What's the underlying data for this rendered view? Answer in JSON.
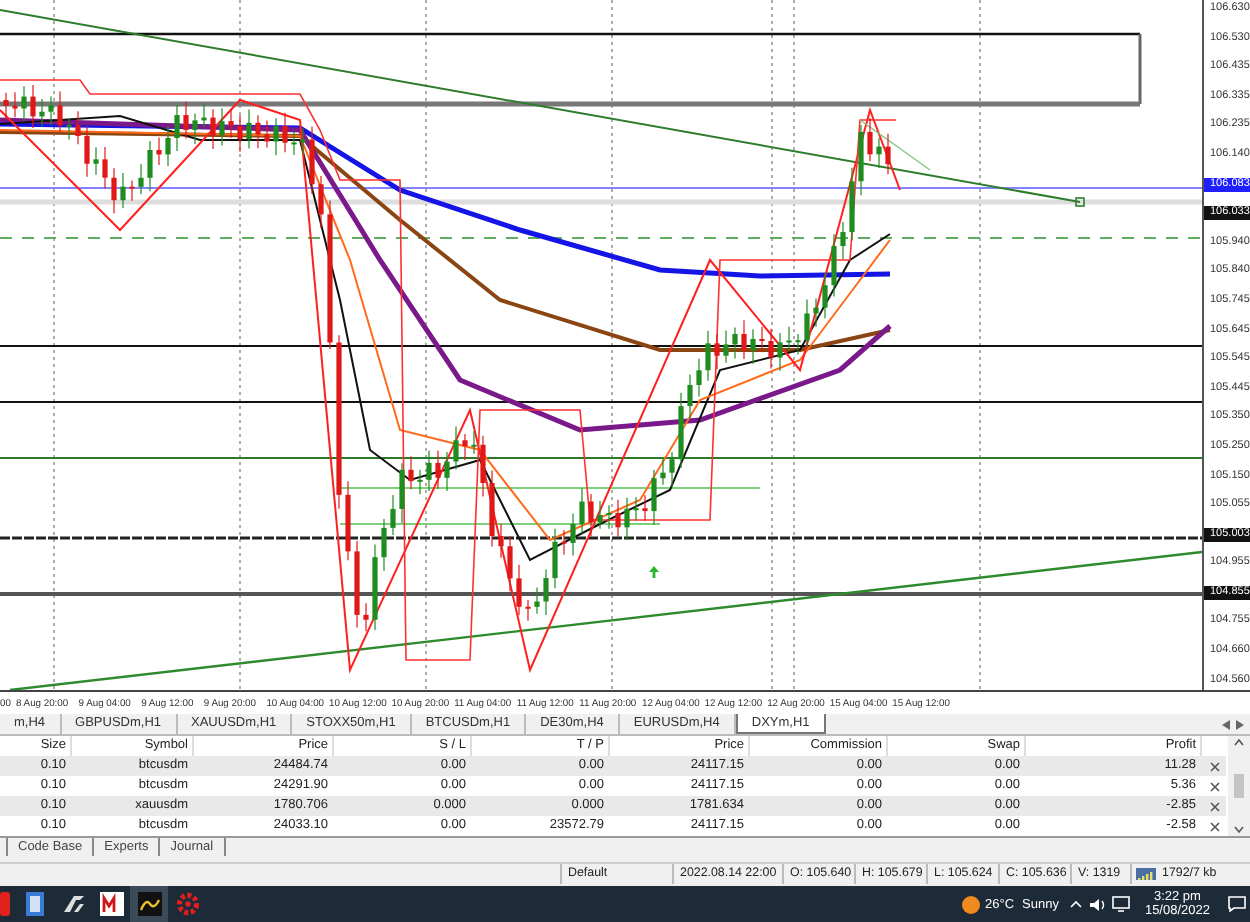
{
  "chart": {
    "price_axis": [
      {
        "label": "106.630",
        "kind": "tick"
      },
      {
        "label": "106.530",
        "kind": "tick"
      },
      {
        "label": "106.435",
        "kind": "tick"
      },
      {
        "label": "106.335",
        "kind": "tick"
      },
      {
        "label": "106.235",
        "kind": "tick"
      },
      {
        "label": "106.140",
        "kind": "tick"
      },
      {
        "label": "106.083",
        "kind": "marker",
        "color": "#1f1fff"
      },
      {
        "label": "106.033",
        "kind": "marker",
        "color": "#111111"
      },
      {
        "label": "105.940",
        "kind": "tick"
      },
      {
        "label": "105.840",
        "kind": "tick"
      },
      {
        "label": "105.745",
        "kind": "tick"
      },
      {
        "label": "105.645",
        "kind": "tick"
      },
      {
        "label": "105.545",
        "kind": "tick"
      },
      {
        "label": "105.445",
        "kind": "tick"
      },
      {
        "label": "105.350",
        "kind": "tick"
      },
      {
        "label": "105.250",
        "kind": "tick"
      },
      {
        "label": "105.150",
        "kind": "tick"
      },
      {
        "label": "105.055",
        "kind": "tick"
      },
      {
        "label": "105.003",
        "kind": "marker",
        "color": "#111111"
      },
      {
        "label": "104.955",
        "kind": "tick"
      },
      {
        "label": "104.855",
        "kind": "marker",
        "color": "#111111"
      },
      {
        "label": "104.755",
        "kind": "tick"
      },
      {
        "label": "104.660",
        "kind": "tick"
      },
      {
        "label": "104.560",
        "kind": "tick"
      }
    ],
    "time_axis": [
      "00",
      "8 Aug 20:00",
      "9 Aug 04:00",
      "9 Aug 12:00",
      "9 Aug 20:00",
      "10 Aug 04:00",
      "10 Aug 12:00",
      "10 Aug 20:00",
      "11 Aug 04:00",
      "11 Aug 12:00",
      "11 Aug 20:00",
      "12 Aug 04:00",
      "12 Aug 12:00",
      "12 Aug 20:00",
      "15 Aug 04:00",
      "15 Aug 12:00"
    ]
  },
  "chart_tabs": [
    {
      "label": "m,H4",
      "selected": false
    },
    {
      "label": "GBPUSDm,H1",
      "selected": false
    },
    {
      "label": "XAUUSDm,H1",
      "selected": false
    },
    {
      "label": "STOXX50m,H1",
      "selected": false
    },
    {
      "label": "BTCUSDm,H1",
      "selected": false
    },
    {
      "label": "DE30m,H4",
      "selected": false
    },
    {
      "label": "EURUSDm,H4",
      "selected": false
    },
    {
      "label": "DXYm,H1",
      "selected": true
    }
  ],
  "trade_table": {
    "columns": [
      "Size",
      "Symbol",
      "Price",
      "S / L",
      "T / P",
      "Price",
      "Commission",
      "Swap",
      "Profit"
    ],
    "rows": [
      [
        "0.10",
        "btcusdm",
        "24484.74",
        "0.00",
        "0.00",
        "24117.15",
        "0.00",
        "0.00",
        "11.28"
      ],
      [
        "0.10",
        "btcusdm",
        "24291.90",
        "0.00",
        "0.00",
        "24117.15",
        "0.00",
        "0.00",
        "5.36"
      ],
      [
        "0.10",
        "xauusdm",
        "1780.706",
        "0.000",
        "0.000",
        "1781.634",
        "0.00",
        "0.00",
        "-2.85"
      ],
      [
        "0.10",
        "btcusdm",
        "24033.10",
        "0.00",
        "23572.79",
        "24117.15",
        "0.00",
        "0.00",
        "-2.58"
      ]
    ]
  },
  "bottom_tabs": [
    "Code Base",
    "Experts",
    "Journal"
  ],
  "status_bar": {
    "profile": "Default",
    "time": "2022.08.14 22:00",
    "open": "O: 105.640",
    "high": "H: 105.679",
    "low": "L: 105.624",
    "close": "C: 105.636",
    "volume": "V: 1319",
    "traffic": "1792/7 kb"
  },
  "taskbar": {
    "temperature": "26°C",
    "weather": "Sunny",
    "time": "3:22 pm",
    "date": "15/08/2022"
  }
}
